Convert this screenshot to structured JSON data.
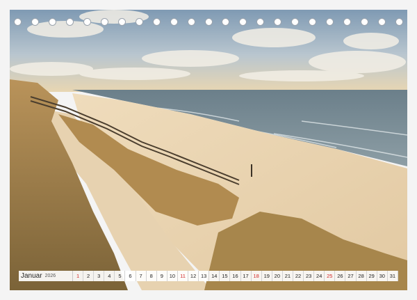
{
  "calendar": {
    "month": "Januar",
    "year": "2026",
    "days": [
      "1",
      "2",
      "3",
      "4",
      "5",
      "6",
      "7",
      "8",
      "9",
      "10",
      "11",
      "12",
      "13",
      "14",
      "15",
      "16",
      "17",
      "18",
      "19",
      "20",
      "21",
      "22",
      "23",
      "24",
      "25",
      "26",
      "27",
      "28",
      "29",
      "30",
      "31"
    ],
    "highlight_days": [
      "1",
      "11",
      "18",
      "25"
    ],
    "highlight_color": "#d12a2a"
  },
  "binding": {
    "hole_count": 23
  },
  "photo": {
    "subject": "beach-dunes-boardwalk",
    "colors": {
      "sky": "#9fb6c9",
      "sea": "#5f7582",
      "sand": "#e8d5b4",
      "grass": "#b08a4e"
    }
  }
}
